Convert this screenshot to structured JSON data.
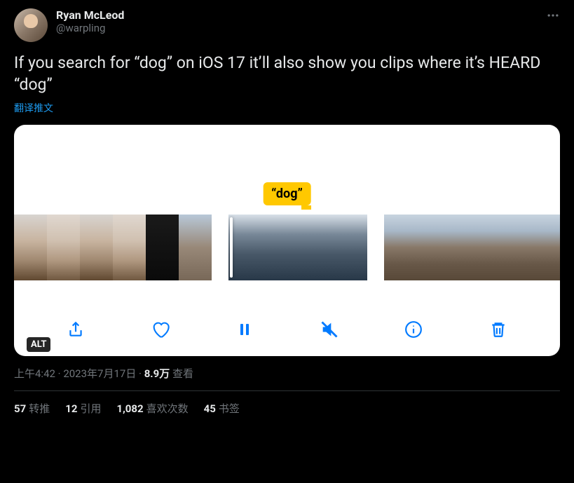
{
  "user": {
    "display_name": "Ryan McLeod",
    "handle": "@warpling"
  },
  "tweet_text": "If you search for “dog” on iOS 17 it’ll also show you clips where it’s HEARD “dog”",
  "translate_label": "翻译推文",
  "media": {
    "search_term": "“dog”",
    "alt_badge": "ALT"
  },
  "meta": {
    "time": "上午4:42",
    "separator1": " · ",
    "date": "2023年7月17日",
    "separator2": " · ",
    "views_count": "8.9万",
    "views_label": " 查看"
  },
  "stats": {
    "retweets_count": "57",
    "retweets_label": "转推",
    "quotes_count": "12",
    "quotes_label": "引用",
    "likes_count": "1,082",
    "likes_label": "喜欢次数",
    "bookmarks_count": "45",
    "bookmarks_label": "书签"
  }
}
